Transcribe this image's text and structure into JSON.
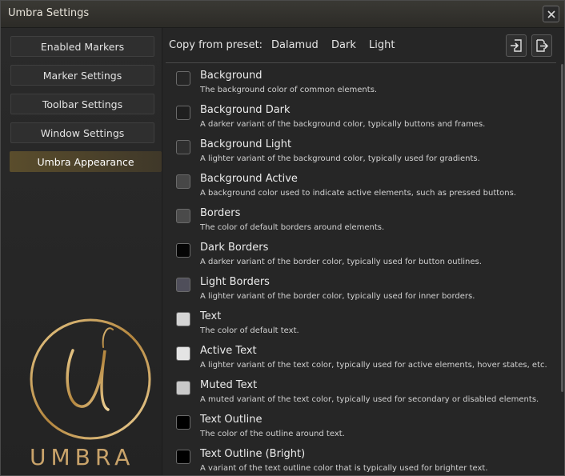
{
  "window": {
    "title": "Umbra Settings"
  },
  "sidebar": {
    "items": [
      {
        "label": "Enabled Markers"
      },
      {
        "label": "Marker Settings"
      },
      {
        "label": "Toolbar Settings"
      },
      {
        "label": "Window Settings"
      },
      {
        "label": "Umbra Appearance",
        "active": true
      }
    ],
    "logo_text": "UMBRA"
  },
  "presets": {
    "label": "Copy from preset:",
    "options": [
      "Dalamud",
      "Dark",
      "Light"
    ],
    "icons": [
      "import-icon",
      "export-icon"
    ]
  },
  "colors": [
    {
      "name": "Background",
      "description": "The background color of common elements.",
      "color": "#262626"
    },
    {
      "name": "Background Dark",
      "description": "A darker variant of the background color, typically buttons and frames.",
      "color": "#1f1f1f"
    },
    {
      "name": "Background Light",
      "description": "A lighter variant of the background color, typically used for gradients.",
      "color": "#2f2f2f"
    },
    {
      "name": "Background Active",
      "description": "A background color used to indicate active elements, such as pressed buttons.",
      "color": "#474747"
    },
    {
      "name": "Borders",
      "description": "The color of default borders around elements.",
      "color": "#4a4a4a"
    },
    {
      "name": "Dark Borders",
      "description": "A darker variant of the border color, typically used for button outlines.",
      "color": "#050505"
    },
    {
      "name": "Light Borders",
      "description": "A lighter variant of the border color, typically used for inner borders.",
      "color": "#4f4e5a"
    },
    {
      "name": "Text",
      "description": "The color of default text.",
      "color": "#d4d4d4"
    },
    {
      "name": "Active Text",
      "description": "A lighter variant of the text color, typically used for active elements, hover states, etc.",
      "color": "#e4e4e4"
    },
    {
      "name": "Muted Text",
      "description": "A muted variant of the text color, typically used for secondary or disabled elements.",
      "color": "#c9c9c9"
    },
    {
      "name": "Text Outline",
      "description": "The color of the outline around text.",
      "color": "#000000"
    },
    {
      "name": "Text Outline (Bright)",
      "description": "A variant of the text outline color that is typically used for brighter text.",
      "color": "#000000"
    }
  ]
}
